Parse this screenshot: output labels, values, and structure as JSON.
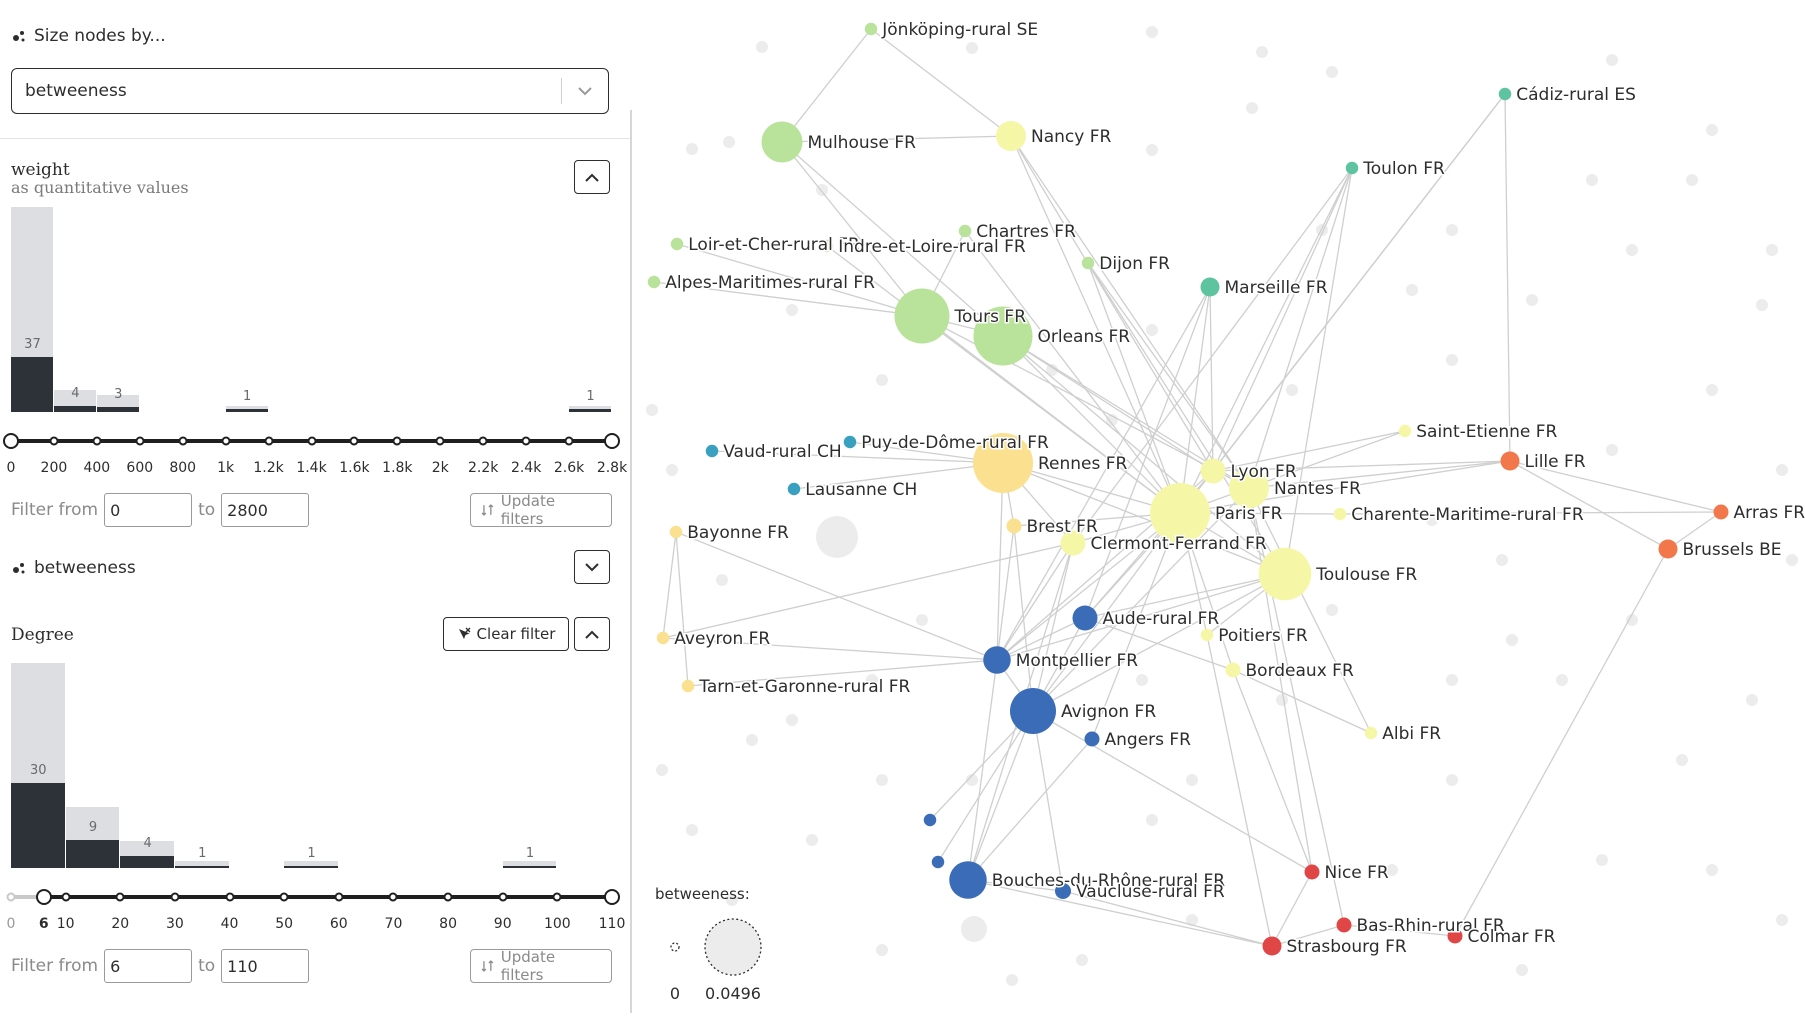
{
  "size_control": {
    "label": "Size nodes by...",
    "selected": "betweeness"
  },
  "weight_filter": {
    "title": "weight",
    "subtitle": "as quantitative values",
    "histogram": {
      "bins": [
        {
          "total": 37,
          "filtered": 37,
          "label": "37"
        },
        {
          "total": 4,
          "filtered": 4,
          "label": "4"
        },
        {
          "total": 3,
          "filtered": 3,
          "label": "3"
        },
        {
          "total": 0,
          "filtered": 0,
          "label": ""
        },
        {
          "total": 0,
          "filtered": 0,
          "label": ""
        },
        {
          "total": 1,
          "filtered": 1,
          "label": "1"
        },
        {
          "total": 0,
          "filtered": 0,
          "label": ""
        },
        {
          "total": 0,
          "filtered": 0,
          "label": ""
        },
        {
          "total": 0,
          "filtered": 0,
          "label": ""
        },
        {
          "total": 0,
          "filtered": 0,
          "label": ""
        },
        {
          "total": 0,
          "filtered": 0,
          "label": ""
        },
        {
          "total": 0,
          "filtered": 0,
          "label": ""
        },
        {
          "total": 0,
          "filtered": 0,
          "label": ""
        },
        {
          "total": 1,
          "filtered": 1,
          "label": "1"
        }
      ],
      "bar_values_full": 37,
      "full_height_value": 37,
      "selected_height_value": 10
    },
    "ticks": [
      "0",
      "200",
      "400",
      "600",
      "800",
      "1k",
      "1.2k",
      "1.4k",
      "1.6k",
      "1.8k",
      "2k",
      "2.2k",
      "2.4k",
      "2.6k",
      "2.8k"
    ],
    "min": 0,
    "max": 2800,
    "filter_from_label": "Filter from",
    "filter_to_label": "to",
    "from_value": "0",
    "to_value": "2800",
    "update_label": "Update filters"
  },
  "betweeness_section": {
    "label": "betweeness"
  },
  "degree_filter": {
    "title": "Degree",
    "clear_label": "Clear filter",
    "histogram": {
      "bins": [
        {
          "total": 30,
          "selected": 8,
          "label": "30"
        },
        {
          "total": 9,
          "selected": 9,
          "label": "9"
        },
        {
          "total": 4,
          "selected": 4,
          "label": "4"
        },
        {
          "total": 1,
          "selected": 1,
          "label": "1"
        },
        {
          "total": 0,
          "selected": 0,
          "label": ""
        },
        {
          "total": 1,
          "selected": 1,
          "label": "1"
        },
        {
          "total": 0,
          "selected": 0,
          "label": ""
        },
        {
          "total": 0,
          "selected": 0,
          "label": ""
        },
        {
          "total": 0,
          "selected": 0,
          "label": ""
        },
        {
          "total": 1,
          "selected": 1,
          "label": "1"
        }
      ]
    },
    "ticks": [
      "0",
      "6",
      "10",
      "20",
      "30",
      "40",
      "50",
      "60",
      "70",
      "80",
      "90",
      "100",
      "110"
    ],
    "min": 0,
    "max": 110,
    "range_from": 6,
    "range_to": 110,
    "filter_from_label": "Filter from",
    "filter_to_label": "to",
    "from_value": "6",
    "to_value": "110",
    "update_label": "Update filters"
  },
  "graph": {
    "legend": {
      "title": "betweeness:",
      "min_label": "0",
      "max_label": "0.0496"
    },
    "colors": {
      "green": "#b9e29a",
      "lightyellow": "#f6f7a6",
      "yellow": "#fbe08f",
      "teal": "#5ec4a0",
      "blue": "#3b6cb8",
      "cyan": "#3aa0c0",
      "orange": "#f2774a",
      "red": "#e04646",
      "edge": "#cfcfcf",
      "faded": "#ececec"
    },
    "nodes": [
      {
        "id": "jonkoping",
        "label": "Jönköping-rural SE",
        "color": "green",
        "size": 0.05
      },
      {
        "id": "mulhouse",
        "label": "Mulhouse FR",
        "color": "green",
        "size": 0.62
      },
      {
        "id": "nancy",
        "label": "Nancy FR",
        "color": "lightyellow",
        "size": 0.4
      },
      {
        "id": "cadiz",
        "label": "Cádiz-rural ES",
        "color": "teal",
        "size": 0.05
      },
      {
        "id": "toulon",
        "label": "Toulon FR",
        "color": "teal",
        "size": 0.05
      },
      {
        "id": "chartres",
        "label": "Chartres FR",
        "color": "green",
        "size": 0.05
      },
      {
        "id": "loircher",
        "label": "Loir-et-Cher-rural FR",
        "color": "green",
        "size": 0.05
      },
      {
        "id": "indreloire",
        "label": "Indre-et-Loire-rural FR",
        "color": "green",
        "size": 0.05
      },
      {
        "id": "dijon",
        "label": "Dijon FR",
        "color": "green",
        "size": 0.05
      },
      {
        "id": "alpesmaritimes",
        "label": "Alpes-Maritimes-rural FR",
        "color": "green",
        "size": 0.05
      },
      {
        "id": "marseille",
        "label": "Marseille FR",
        "color": "teal",
        "size": 0.18
      },
      {
        "id": "tours",
        "label": "Tours FR",
        "color": "green",
        "size": 0.9
      },
      {
        "id": "orleans",
        "label": "Orleans FR",
        "color": "green",
        "size": 0.98
      },
      {
        "id": "saintetienne",
        "label": "Saint-Etienne FR",
        "color": "lightyellow",
        "size": 0.05
      },
      {
        "id": "vaud",
        "label": "Vaud-rural CH",
        "color": "cyan",
        "size": 0.05
      },
      {
        "id": "puydedome",
        "label": "Puy-de-Dôme-rural FR",
        "color": "cyan",
        "size": 0.05
      },
      {
        "id": "rennes",
        "label": "Rennes FR",
        "color": "yellow",
        "size": 1.0
      },
      {
        "id": "lyon",
        "label": "Lyon FR",
        "color": "lightyellow",
        "size": 0.3
      },
      {
        "id": "lille",
        "label": "Lille FR",
        "color": "orange",
        "size": 0.18
      },
      {
        "id": "nantes",
        "label": "Nantes FR",
        "color": "lightyellow",
        "size": 0.6
      },
      {
        "id": "arras",
        "label": "Arras FR",
        "color": "orange",
        "size": 0.1
      },
      {
        "id": "lausanne",
        "label": "Lausanne CH",
        "color": "cyan",
        "size": 0.05
      },
      {
        "id": "paris",
        "label": "Paris FR",
        "color": "lightyellow",
        "size": 1.0
      },
      {
        "id": "charente",
        "label": "Charente-Maritime-rural FR",
        "color": "lightyellow",
        "size": 0.05
      },
      {
        "id": "bayonne",
        "label": "Bayonne FR",
        "color": "yellow",
        "size": 0.05
      },
      {
        "id": "brest",
        "label": "Brest FR",
        "color": "yellow",
        "size": 0.1
      },
      {
        "id": "clermont",
        "label": "Clermont-Ferrand FR",
        "color": "lightyellow",
        "size": 0.3
      },
      {
        "id": "brussels",
        "label": "Brussels BE",
        "color": "orange",
        "size": 0.18
      },
      {
        "id": "toulouse",
        "label": "Toulouse FR",
        "color": "lightyellow",
        "size": 0.85
      },
      {
        "id": "aude",
        "label": "Aude-rural FR",
        "color": "blue",
        "size": 0.3
      },
      {
        "id": "aveyron",
        "label": "Aveyron FR",
        "color": "yellow",
        "size": 0.05
      },
      {
        "id": "poitiers",
        "label": "Poitiers FR",
        "color": "lightyellow",
        "size": 0.05
      },
      {
        "id": "montpellier",
        "label": "Montpellier FR",
        "color": "blue",
        "size": 0.35
      },
      {
        "id": "tarnetgaronne",
        "label": "Tarn-et-Garonne-rural FR",
        "color": "yellow",
        "size": 0.05
      },
      {
        "id": "bordeaux",
        "label": "Bordeaux FR",
        "color": "lightyellow",
        "size": 0.1
      },
      {
        "id": "avignon",
        "label": "Avignon FR",
        "color": "blue",
        "size": 0.72
      },
      {
        "id": "albi",
        "label": "Albi FR",
        "color": "lightyellow",
        "size": 0.05
      },
      {
        "id": "angers",
        "label": "Angers FR",
        "color": "blue",
        "size": 0.1
      },
      {
        "id": "nice",
        "label": "Nice FR",
        "color": "red",
        "size": 0.1
      },
      {
        "id": "bouches",
        "label": "Bouches-du-Rhône-rural FR",
        "color": "blue",
        "size": 0.55
      },
      {
        "id": "vaucluse",
        "label": "Vaucluse-rural FR",
        "color": "blue",
        "size": 0.12
      },
      {
        "id": "basrhin",
        "label": "Bas-Rhin-rural FR",
        "color": "red",
        "size": 0.1
      },
      {
        "id": "strasbourg",
        "label": "Strasbourg FR",
        "color": "red",
        "size": 0.18
      },
      {
        "id": "colmar",
        "label": "Colmar FR",
        "color": "red",
        "size": 0.1
      },
      {
        "id": "blue1",
        "label": "",
        "color": "blue",
        "size": 0.05
      },
      {
        "id": "blue2",
        "label": "",
        "color": "blue",
        "size": 0.05
      }
    ],
    "edges": [
      [
        "jonkoping",
        "mulhouse"
      ],
      [
        "jonkoping",
        "nancy"
      ],
      [
        "mulhouse",
        "nancy"
      ],
      [
        "mulhouse",
        "orleans"
      ],
      [
        "mulhouse",
        "tours"
      ],
      [
        "nancy",
        "paris"
      ],
      [
        "nancy",
        "lyon"
      ],
      [
        "nancy",
        "nantes"
      ],
      [
        "cadiz",
        "lille"
      ],
      [
        "cadiz",
        "paris"
      ],
      [
        "cadiz",
        "lyon"
      ],
      [
        "toulon",
        "paris"
      ],
      [
        "toulon",
        "lyon"
      ],
      [
        "toulon",
        "nantes"
      ],
      [
        "toulon",
        "toulouse"
      ],
      [
        "toulon",
        "clermont"
      ],
      [
        "chartres",
        "tours"
      ],
      [
        "chartres",
        "paris"
      ],
      [
        "loircher",
        "tours"
      ],
      [
        "alpesmaritimes",
        "tours"
      ],
      [
        "indreloire",
        "paris"
      ],
      [
        "dijon",
        "paris"
      ],
      [
        "dijon",
        "nantes"
      ],
      [
        "dijon",
        "toulouse"
      ],
      [
        "marseille",
        "paris"
      ],
      [
        "marseille",
        "lyon"
      ],
      [
        "marseille",
        "montpellier"
      ],
      [
        "marseille",
        "aude"
      ],
      [
        "tours",
        "orleans"
      ],
      [
        "tours",
        "paris"
      ],
      [
        "tours",
        "nantes"
      ],
      [
        "orleans",
        "paris"
      ],
      [
        "orleans",
        "lyon"
      ],
      [
        "orleans",
        "nantes"
      ],
      [
        "orleans",
        "toulouse"
      ],
      [
        "saintetienne",
        "paris"
      ],
      [
        "saintetienne",
        "lyon"
      ],
      [
        "vaud",
        "rennes"
      ],
      [
        "puydedome",
        "rennes"
      ],
      [
        "rennes",
        "paris"
      ],
      [
        "rennes",
        "clermont"
      ],
      [
        "rennes",
        "brest"
      ],
      [
        "rennes",
        "toulouse"
      ],
      [
        "rennes",
        "montpellier"
      ],
      [
        "lyon",
        "paris"
      ],
      [
        "lyon",
        "lille"
      ],
      [
        "lille",
        "paris"
      ],
      [
        "lille",
        "arras"
      ],
      [
        "lille",
        "brussels"
      ],
      [
        "lille",
        "nantes"
      ],
      [
        "arras",
        "brussels"
      ],
      [
        "arras",
        "charente"
      ],
      [
        "lausanne",
        "rennes"
      ],
      [
        "paris",
        "charente"
      ],
      [
        "paris",
        "clermont"
      ],
      [
        "paris",
        "toulouse"
      ],
      [
        "paris",
        "aude"
      ],
      [
        "paris",
        "montpellier"
      ],
      [
        "paris",
        "avignon"
      ],
      [
        "paris",
        "bordeaux"
      ],
      [
        "paris",
        "brest"
      ],
      [
        "paris",
        "poitiers"
      ],
      [
        "paris",
        "angers"
      ],
      [
        "bayonne",
        "aveyron"
      ],
      [
        "bayonne",
        "tarnetgaronne"
      ],
      [
        "bayonne",
        "montpellier"
      ],
      [
        "brest",
        "montpellier"
      ],
      [
        "brest",
        "avignon"
      ],
      [
        "clermont",
        "avignon"
      ],
      [
        "clermont",
        "montpellier"
      ],
      [
        "clermont",
        "aveyron"
      ],
      [
        "clermont",
        "bouches"
      ],
      [
        "brussels",
        "colmar"
      ],
      [
        "toulouse",
        "aude"
      ],
      [
        "toulouse",
        "avignon"
      ],
      [
        "toulouse",
        "montpellier"
      ],
      [
        "toulouse",
        "poitiers"
      ],
      [
        "aude",
        "montpellier"
      ],
      [
        "aude",
        "avignon"
      ],
      [
        "aude",
        "bordeaux"
      ],
      [
        "aveyron",
        "montpellier"
      ],
      [
        "montpellier",
        "avignon"
      ],
      [
        "montpellier",
        "bouches"
      ],
      [
        "montpellier",
        "tarnetgaronne"
      ],
      [
        "avignon",
        "bouches"
      ],
      [
        "avignon",
        "vaucluse"
      ],
      [
        "avignon",
        "blue1"
      ],
      [
        "avignon",
        "blue2"
      ],
      [
        "avignon",
        "nice"
      ],
      [
        "bordeaux",
        "albi"
      ],
      [
        "bordeaux",
        "nice"
      ],
      [
        "poitiers",
        "strasbourg"
      ],
      [
        "nantes",
        "albi"
      ],
      [
        "nantes",
        "nice"
      ],
      [
        "bouches",
        "strasbourg"
      ],
      [
        "bouches",
        "vaucluse"
      ],
      [
        "vaucluse",
        "strasbourg"
      ],
      [
        "strasbourg",
        "basrhin"
      ],
      [
        "strasbourg",
        "nice"
      ],
      [
        "basrhin",
        "colmar"
      ],
      [
        "angers",
        "bouches"
      ],
      [
        "nantes",
        "basrhin"
      ],
      [
        "lyon",
        "aude"
      ],
      [
        "lyon",
        "montpellier"
      ],
      [
        "nantes",
        "avignon"
      ]
    ]
  }
}
